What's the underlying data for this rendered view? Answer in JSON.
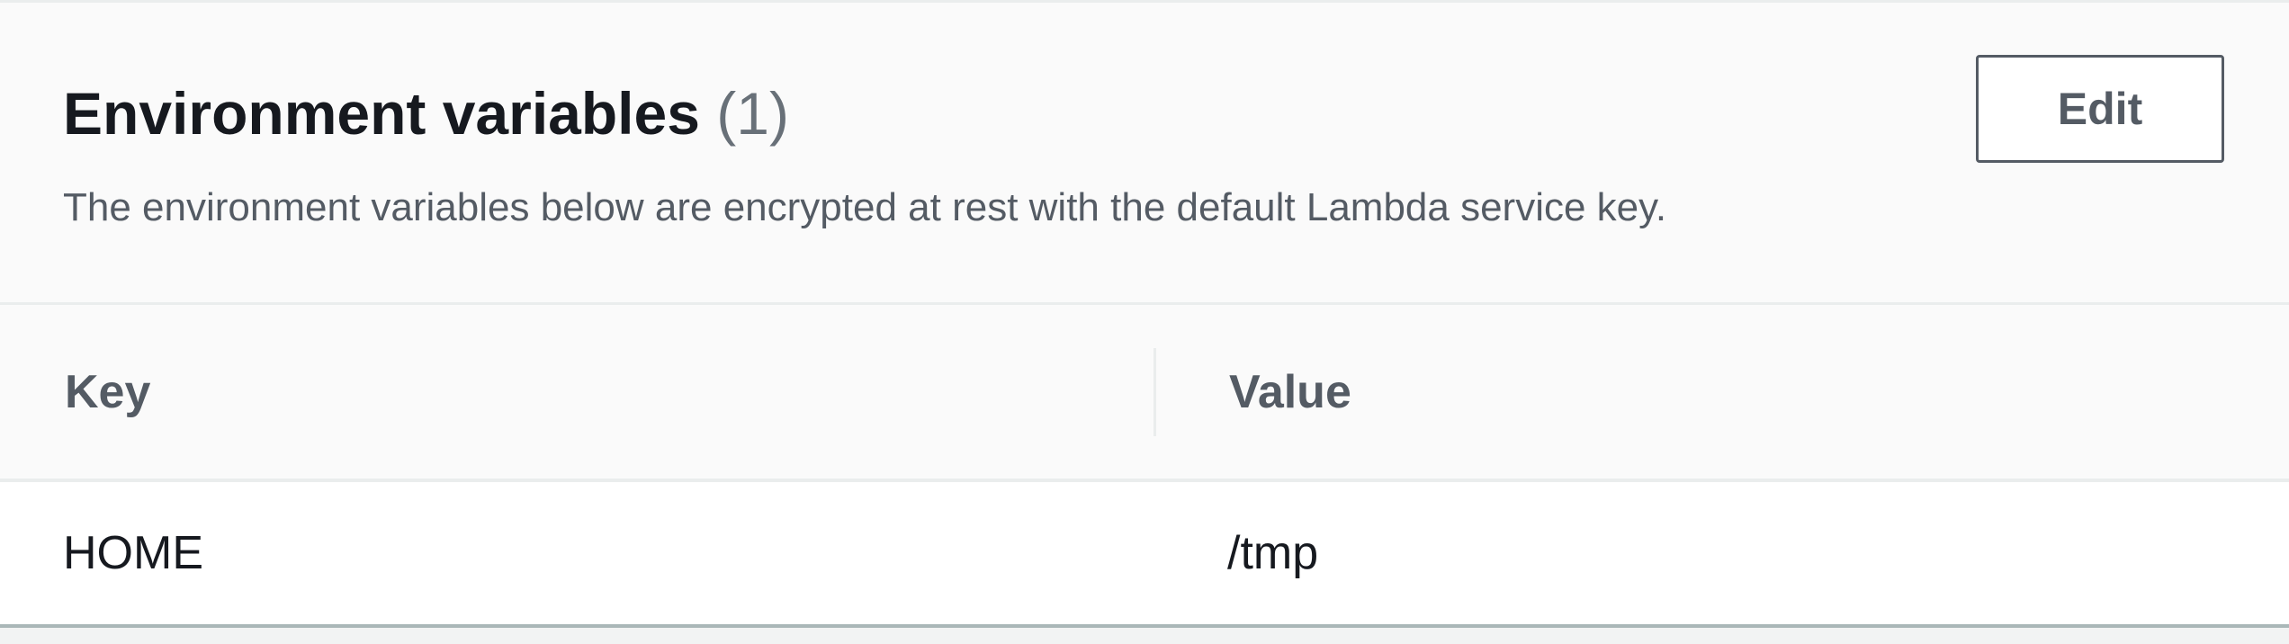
{
  "section": {
    "title": "Environment variables",
    "count": "(1)",
    "description": "The environment variables below are encrypted at rest with the default Lambda service key.",
    "edit_label": "Edit"
  },
  "table": {
    "columns": [
      "Key",
      "Value"
    ],
    "rows": [
      {
        "key": "HOME",
        "value": "/tmp"
      }
    ]
  }
}
